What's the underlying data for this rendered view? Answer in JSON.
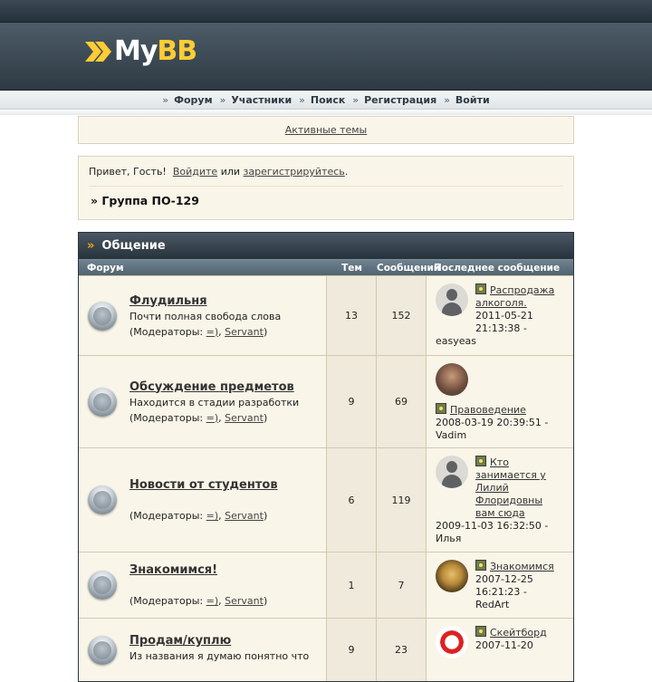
{
  "header": {
    "logo_text_main": "My",
    "logo_text_accent": "BB"
  },
  "menu": [
    {
      "label": "Форум"
    },
    {
      "label": "Участники"
    },
    {
      "label": "Поиск"
    },
    {
      "label": "Регистрация"
    },
    {
      "label": "Войти"
    }
  ],
  "active_topics_link": "Активные темы",
  "welcome": {
    "greeting": "Привет, Гость!",
    "login_link": "Войдите",
    "or_text": "или",
    "register_link": "зарегистрируйтесь",
    "period": "."
  },
  "group": {
    "title": "» Группа ПО-129"
  },
  "category": {
    "title": "Общение",
    "columns": {
      "forum": "Форум",
      "topics": "Тем",
      "posts": "Сообщений",
      "last_post": "Последнее сообщение"
    }
  },
  "moderators_label": "(Модераторы:",
  "moderator_1": "=)",
  "moderator_sep": ",",
  "moderator_2": "Servant",
  "moderators_close": ")",
  "forums": [
    {
      "title": "Флудильня",
      "description": "Почти полная свобода слова",
      "topics": "13",
      "posts": "152",
      "last_post": {
        "title": "Распродажа алкоголя.",
        "date": "2011-05-21 21:13:38 -",
        "author": "easyeas",
        "avatar": "default"
      }
    },
    {
      "title": "Обсуждение предметов",
      "description": "Находится в стадии разработки",
      "topics": "9",
      "posts": "69",
      "last_post": {
        "title": "Правоведение",
        "date": "2008-03-19 20:39:51 -",
        "author": "Vadim",
        "avatar": "photo"
      }
    },
    {
      "title": "Новости от студентов",
      "description": "",
      "topics": "6",
      "posts": "119",
      "last_post": {
        "title": "Кто занимается у Лилий Флоридовны вам сюда",
        "date": "2009-11-03 16:32:50 -",
        "author": "Илья",
        "avatar": "default"
      }
    },
    {
      "title": "Знакомимся!",
      "description": "",
      "topics": "1",
      "posts": "7",
      "last_post": {
        "title": "Знакомимся",
        "date": "2007-12-25 16:21:23 -",
        "author": "RedArt",
        "avatar": "skull"
      }
    },
    {
      "title": "Продам/куплю",
      "description": "Из названия я думаю понятно что",
      "topics": "9",
      "posts": "23",
      "last_post": {
        "title": "Скейтборд",
        "date": "2007-11-20",
        "author": "",
        "avatar": "devil"
      }
    }
  ]
}
